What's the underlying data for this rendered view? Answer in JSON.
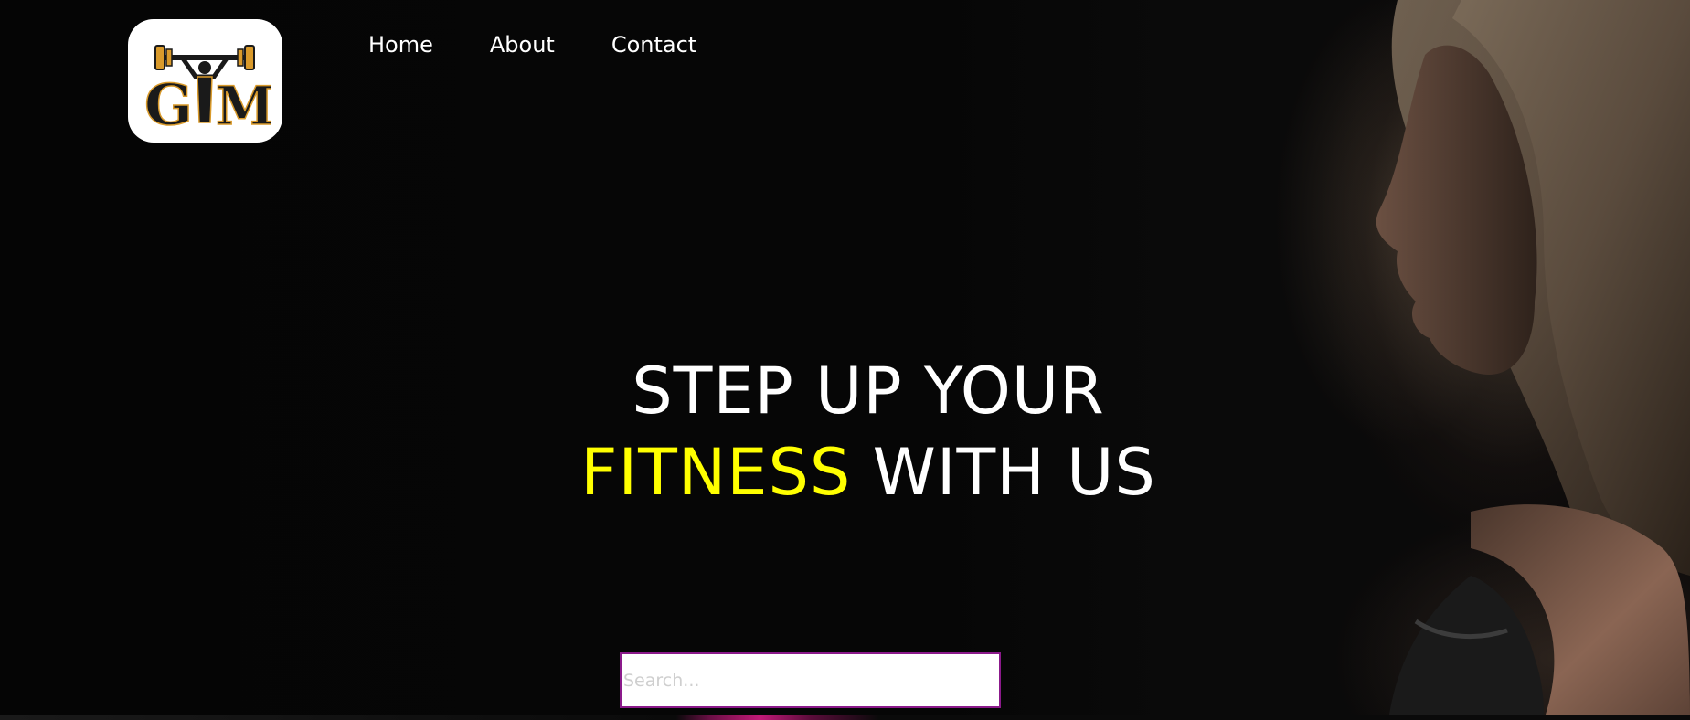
{
  "logo": {
    "text": "GYM",
    "alt": "GYM logo",
    "colors": {
      "background": "#ffffff",
      "letters": "#1a1a1a",
      "gold": "#d99a2b"
    }
  },
  "nav": {
    "items": [
      {
        "label": "Home"
      },
      {
        "label": "About"
      },
      {
        "label": "Contact"
      }
    ]
  },
  "hero": {
    "line1": "STEP UP YOUR",
    "accent": "FITNESS",
    "line2_rest": "WITH US",
    "colors": {
      "text": "#ffffff",
      "accent": "#ffff00",
      "background": "#040404"
    }
  },
  "search": {
    "placeholder": "Search...",
    "value": "",
    "border_color": "#8b1a8b"
  }
}
